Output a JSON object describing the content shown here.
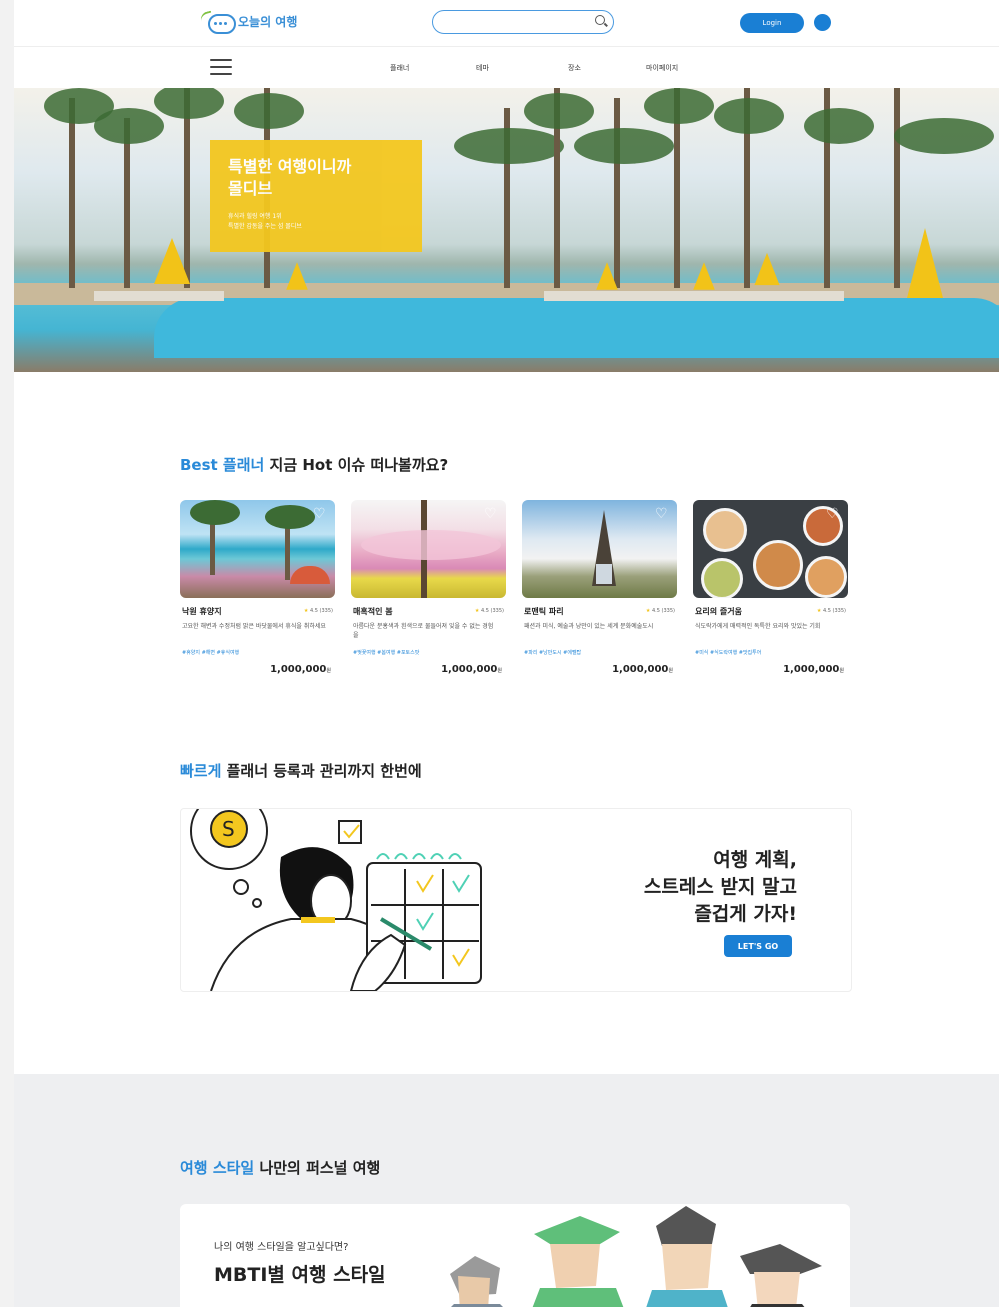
{
  "header": {
    "logo_text": "오늘의 여행",
    "search_placeholder": "",
    "login_label": "Login"
  },
  "nav": {
    "items": [
      "플래너",
      "테마",
      "장소",
      "마이페이지"
    ]
  },
  "hero": {
    "title_line1": "특별한 여행이니까",
    "title_line2": "몰디브",
    "sub_line1": "휴식과 힐링 여행 1위",
    "sub_line2": "특별한 감동을 주는 섬 몰디브"
  },
  "best": {
    "title_accent": "Best 플래너",
    "title_rest": " 지금 Hot 이슈 떠나볼까요?",
    "cards": [
      {
        "name": "낙원 휴양지",
        "rating": "4.5 (335)",
        "desc": "고요한 해변과 수정처럼 맑은 바닷물에서 휴식을 취하세요",
        "tags": "#휴양지  #해변  #휴식여행",
        "price": "1,000,000",
        "unit": "원"
      },
      {
        "name": "매혹적인 봄",
        "rating": "4.5 (335)",
        "desc": "아름다운 분홍색과 흰색으로 물들어져 잊을 수 없는 경험을",
        "tags": "#벚꽃여행  #봄여행  #포토스팟",
        "price": "1,000,000",
        "unit": "원"
      },
      {
        "name": "로맨틱 파리",
        "rating": "4.5 (335)",
        "desc": "패션과 미식, 예술과 낭만이 있는 세계 문화예술도시",
        "tags": "#파리  #낭만도시  #에펠탑",
        "price": "1,000,000",
        "unit": "원"
      },
      {
        "name": "요리의 즐거움",
        "rating": "4.5 (335)",
        "desc": "식도락가에게 매력적인 독특한 요리와 맛있는 기회",
        "tags": "#미식  #식도락여행  #맛집투어",
        "price": "1,000,000",
        "unit": "원"
      }
    ]
  },
  "planner": {
    "title_accent": "빠르게",
    "title_rest": " 플래너 등록과 관리까지 한번에",
    "line1": "여행 계획,",
    "line2": "스트레스 받지 말고",
    "line3": "즐겁게 가자!",
    "button": "LET'S GO"
  },
  "style": {
    "title_accent": "여행 스타일",
    "title_rest": " 나만의 퍼스널 여행",
    "sub": "나의 여행 스타일을 알고싶다면?",
    "main": "MBTI별 여행 스타일"
  },
  "colors": {
    "accent": "#2a8ad8",
    "primary_button": "#1a7fd4",
    "hero_box": "#f3c71f"
  }
}
